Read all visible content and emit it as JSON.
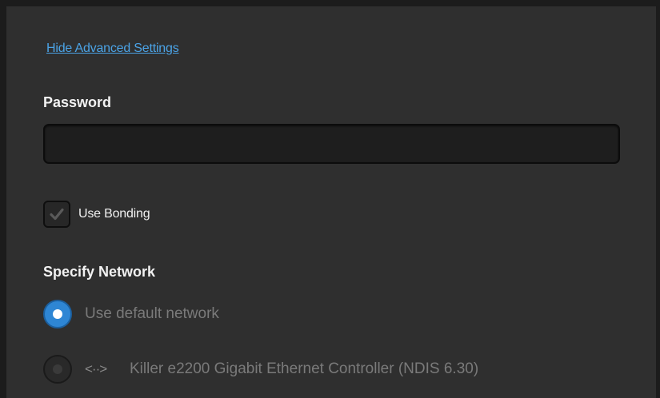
{
  "advanced": {
    "hide_link": "Hide Advanced Settings"
  },
  "password": {
    "label": "Password",
    "value": "",
    "placeholder": ""
  },
  "bonding": {
    "label": "Use Bonding",
    "checked": true
  },
  "network": {
    "label": "Specify Network",
    "options": [
      {
        "label": "Use default network",
        "selected": true
      },
      {
        "icon_text": "<··>",
        "icon": "network-adapter-icon",
        "label": "Killer e2200 Gigabit Ethernet Controller (NDIS 6.30)",
        "selected": false
      }
    ]
  },
  "colors": {
    "panel_bg": "#2f2f2f",
    "link": "#4ba3e6",
    "accent": "#2e86d4",
    "disabled_text": "#7a7a7a"
  }
}
